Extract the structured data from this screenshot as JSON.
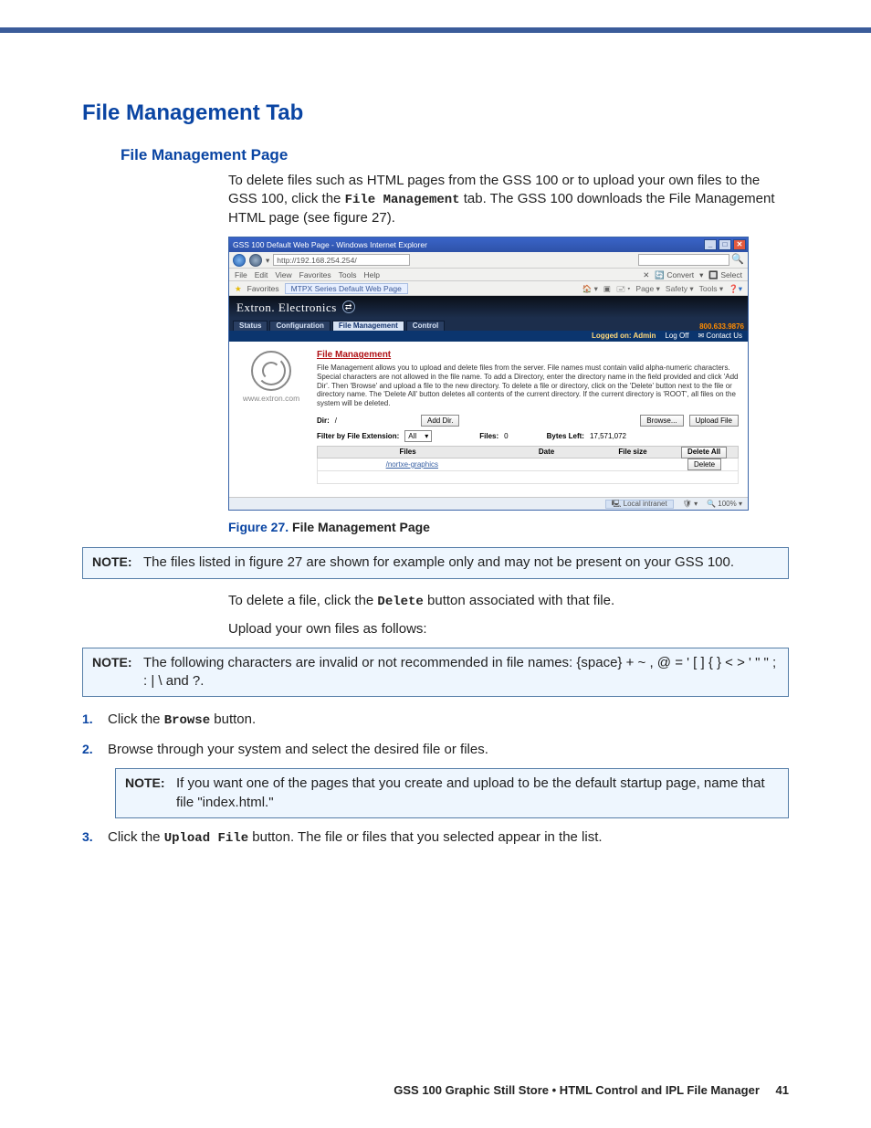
{
  "page": {
    "section_title": "File Management Tab",
    "subsection_title": "File Management Page",
    "intro_p1_a": "To delete files such as HTML pages from the GSS 100 or to upload your own files to the GSS 100, click the ",
    "intro_p1_mono": "File Management",
    "intro_p1_b": " tab. The GSS 100 downloads the File Management HTML page (see figure 27).",
    "figure_num": "Figure 27.",
    "figure_title": " File Management Page",
    "note1_label": "NOTE:",
    "note1_body": "The files listed in figure 27 are shown for example only and may not be present on your GSS 100.",
    "p_delete_a": "To delete a file, click the ",
    "p_delete_mono": "Delete",
    "p_delete_b": " button associated with that file.",
    "p_upload": "Upload your own files as follows:",
    "note2_label": "NOTE:",
    "note2_body": "The following characters are invalid or not recommended in file names: {space}  +  ~  ,  @  =  '  [  ]  {  }  <  >  '  \"  \"  ;  :  |  \\  and ?.",
    "step1_a": "Click the ",
    "step1_mono": "Browse",
    "step1_b": " button.",
    "step2": "Browse through your system and select the desired file or files.",
    "note3_label": "NOTE:",
    "note3_body": "If you want one of the pages that you create and upload to be the default startup page, name that file \"index.html.\"",
    "step3_a": "Click the ",
    "step3_mono": "Upload File",
    "step3_b": " button. The file or files that you selected appear in the list.",
    "footer_text": "GSS 100 Graphic Still Store • HTML Control and IPL File Manager",
    "footer_page": "41"
  },
  "shot": {
    "window_title": "GSS 100 Default Web Page - Windows Internet Explorer",
    "address": "http://192.168.254.254/",
    "search_placeholder": "",
    "menu": {
      "file": "File",
      "edit": "Edit",
      "view": "View",
      "favorites": "Favorites",
      "tools": "Tools",
      "help": "Help"
    },
    "convert": "Convert",
    "select": "Select",
    "fav_label": "Favorites",
    "fav_tab": "MTPX Series Default Web Page",
    "toolbar": [
      "Page",
      "Safety",
      "Tools"
    ],
    "banner": "Extron. Electronics",
    "tabs": {
      "status": "Status",
      "config": "Configuration",
      "fm": "File Management",
      "control": "Control"
    },
    "phone": "800.633.9876",
    "logged": "Logged on: Admin",
    "logoff": "Log Off",
    "contact": "Contact Us",
    "site": "www.extron.com",
    "fm_title": "File Management",
    "fm_desc": "File Management allows you to upload and delete files from the server. File names must contain valid alpha-numeric characters. Special characters are not allowed in the file name. To add a Directory, enter the directory name in the field provided and click 'Add Dir'. Then 'Browse' and upload a file to the new directory. To delete a file or directory, click on the 'Delete' button next to the file or directory name. The 'Delete All' button deletes all contents of the current directory. If the current directory is 'ROOT', all files on the system will be deleted.",
    "dir_label": "Dir:",
    "dir_value": "/",
    "add_dir": "Add Dir.",
    "browse": "Browse...",
    "upload_file": "Upload File",
    "filter_label": "Filter by File Extension:",
    "filter_value": "All",
    "files_label": "Files:",
    "files_count": "0",
    "bytes_label": "Bytes Left:",
    "bytes_value": "17,571,072",
    "col_files": "Files",
    "col_date": "Date",
    "col_size": "File size",
    "delete_all": "Delete All",
    "row_link": "/nortxe-graphics",
    "delete": "Delete",
    "zone": "Local intranet",
    "zoom": "100%"
  }
}
